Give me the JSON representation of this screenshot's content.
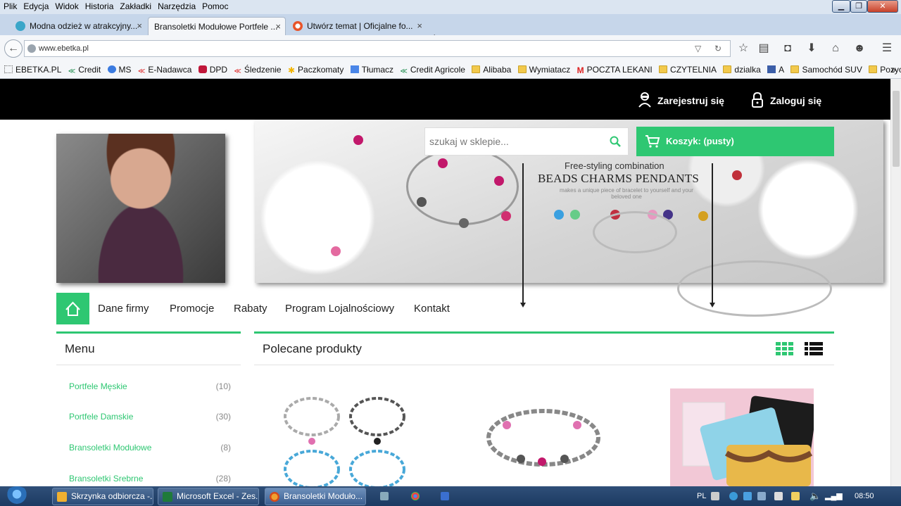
{
  "browser": {
    "menu": [
      "Plik",
      "Edycja",
      "Widok",
      "Historia",
      "Zakładki",
      "Narzędzia",
      "Pomoc"
    ],
    "tabs": [
      {
        "label": "Modna odzież w atrakcyjny...",
        "active": false
      },
      {
        "label": "Bransoletki Modułowe Portfele ...",
        "active": true
      },
      {
        "label": "Utwórz temat | Oficjalne fo...",
        "active": false
      }
    ],
    "url": "www.ebetka.pl",
    "bookmarks": [
      "EBETKA.PL",
      "Credit",
      "MS",
      "E-Nadawca",
      "DPD",
      "Śledzenie",
      "Paczkomaty",
      "Tłumacz",
      "Credit Agricole",
      "Alibaba",
      "Wymiatacz",
      "POCZTA LEKANI",
      "CZYTELNIA",
      "dzialka",
      "A",
      "Samochód SUV",
      "Pozycjonowanie"
    ]
  },
  "site": {
    "register": "Zarejestruj się",
    "login": "Zaloguj się",
    "search_placeholder": "szukaj w sklepie...",
    "cart": "Koszyk: (pusty)",
    "banner": {
      "line1": "Free-styling combination",
      "line2": "BEADS CHARMS PENDANTS",
      "line3": "makes a unique piece of bracelet to yourself and your beloved one"
    },
    "nav": [
      "Dane firmy",
      "Promocje",
      "Rabaty",
      "Program Lojalnościowy",
      "Kontakt"
    ],
    "menu_title": "Menu",
    "featured_title": "Polecane produkty",
    "categories": [
      {
        "name": "Portfele Męskie",
        "count": "(10)"
      },
      {
        "name": "Portfele Damskie",
        "count": "(30)"
      },
      {
        "name": "Bransoletki Modułowe",
        "count": "(8)"
      },
      {
        "name": "Bransoletki Srebrne",
        "count": "(28)"
      }
    ],
    "accent_color": "#2ec772"
  },
  "taskbar": {
    "buttons": [
      "Skrzynka odbiorcza -...",
      "Microsoft Excel - Zes...",
      "Bransoletki Moduło..."
    ],
    "lang": "PL",
    "time": "08:50"
  }
}
